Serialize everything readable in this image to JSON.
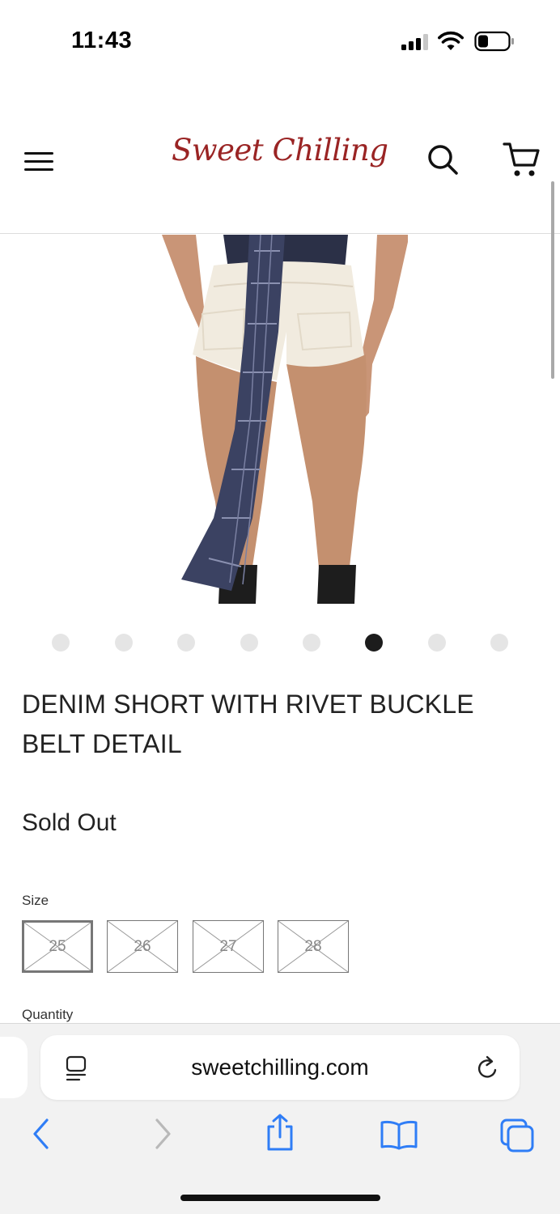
{
  "status_bar": {
    "time": "11:43",
    "icons": [
      "cellular-signal-icon",
      "wifi-icon",
      "battery-icon"
    ]
  },
  "header": {
    "logo_text": "Sweet Chilling",
    "icons": [
      "hamburger-menu-icon",
      "search-icon",
      "cart-icon"
    ]
  },
  "colors": {
    "brand": "#9a2424",
    "text": "#222222",
    "link_blue": "#2f7df6",
    "dot_active": "#1c1c1c",
    "dot_inactive": "#e5e5e5"
  },
  "gallery": {
    "image_count": 8,
    "active_index": 5
  },
  "product": {
    "title": "DENIM SHORT WITH RIVET BUCKLE BELT DETAIL",
    "status": "Sold Out",
    "size_label": "Size",
    "sizes": [
      {
        "value": "25",
        "available": false,
        "selected": true
      },
      {
        "value": "26",
        "available": false,
        "selected": false
      },
      {
        "value": "27",
        "available": false,
        "selected": false
      },
      {
        "value": "28",
        "available": false,
        "selected": false
      }
    ],
    "quantity_label": "Quantity"
  },
  "browser": {
    "url": "sweetchilling.com",
    "toolbar": [
      "back-icon",
      "forward-icon",
      "share-icon",
      "bookmarks-icon",
      "tabs-icon"
    ]
  }
}
